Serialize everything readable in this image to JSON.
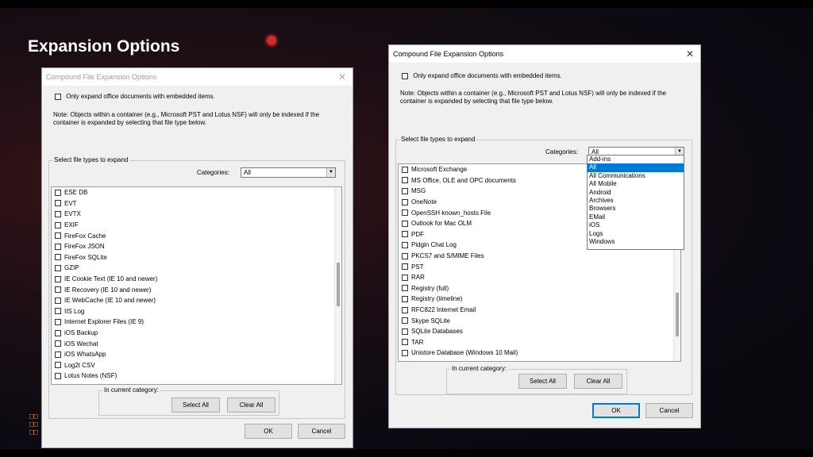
{
  "slide": {
    "title": "Expansion Options"
  },
  "dialog": {
    "title": "Compound File Expansion Options",
    "only_expand_label": "Only expand office documents with embedded items.",
    "note_line1": "Note: Objects within a container (e.g., Microsoft PST and Lotus NSF) will only be indexed if the",
    "note_line2": "container is expanded by selecting that file type below.",
    "group_label": "Select file types to expand",
    "categories_label": "Categories:",
    "selected_category": "All",
    "in_category_label": "In current category:",
    "select_all": "Select All",
    "clear_all": "Clear All",
    "ok": "OK",
    "cancel": "Cancel"
  },
  "left_list": [
    "ESE DB",
    "EVT",
    "EVTX",
    "EXIF",
    "FireFox Cache",
    "FireFox JSON",
    "FireFox SQLite",
    "GZIP",
    "IE Cookie Text (IE 10 and newer)",
    "IE Recovery (IE 10 and newer)",
    "IE WebCache (IE 10 and newer)",
    "IIS Log",
    "Internet Explorer Files (IE 9)",
    "iOS Backup",
    "iOS Wechat",
    "iOS WhatsApp",
    "Log2t CSV",
    "Lotus Notes (NSF)"
  ],
  "right_list": [
    "Microsoft Exchange",
    "MS Office, OLE and OPC documents",
    "MSG",
    "OneNote",
    "OpenSSH known_hosts File",
    "Outlook for Mac OLM",
    "PDF",
    "Pidgin Chat Log",
    "PKCS7 and S/MIME Files",
    "PST",
    "RAR",
    "Registry (full)",
    "Registry (timeline)",
    "RFC822 Internet Email",
    "Skype SQLite",
    "SQLite Databases",
    "TAR",
    "Unistore Database (Windows 10 Mail)"
  ],
  "category_options": [
    "Add-ins",
    "All",
    "All Communications",
    "All Mobile",
    "Android",
    "Archives",
    "Browsers",
    "EMail",
    "iOS",
    "Logs",
    "Windows"
  ],
  "colors": {
    "accent": "#0078d7",
    "rec_dot": "#d42a2a",
    "title_text": "#ffffff"
  }
}
